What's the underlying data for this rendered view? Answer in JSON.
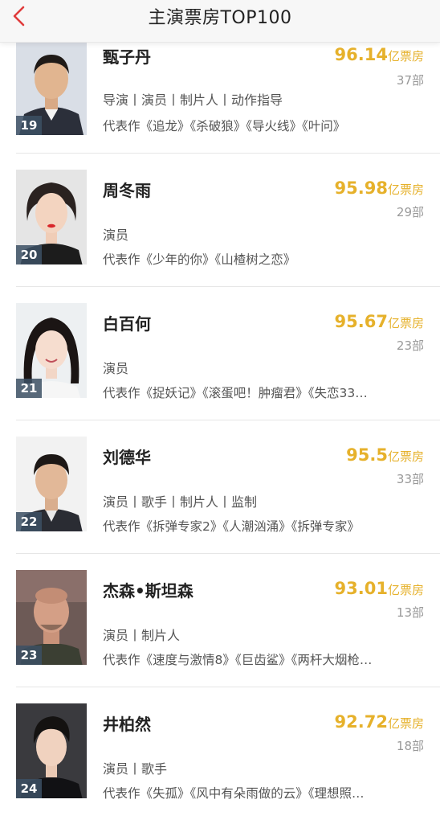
{
  "header": {
    "title": "主演票房TOP100",
    "back_icon": "chevron-left-icon",
    "accent": "#e03c3c"
  },
  "colors": {
    "gross": "#e6b12b",
    "rank_badge": "#3c5064"
  },
  "actors": [
    {
      "rank": "19",
      "name": "甄子丹",
      "gross": "96.14",
      "gross_unit": "亿票房",
      "films": "37部",
      "roles": "导演丨演员丨制片人丨动作指导",
      "works": "代表作《追龙》《杀破狼》《导火线》《叶问》"
    },
    {
      "rank": "20",
      "name": "周冬雨",
      "gross": "95.98",
      "gross_unit": "亿票房",
      "films": "29部",
      "roles": "演员",
      "works": "代表作《少年的你》《山楂树之恋》"
    },
    {
      "rank": "21",
      "name": "白百何",
      "gross": "95.67",
      "gross_unit": "亿票房",
      "films": "23部",
      "roles": "演员",
      "works": "代表作《捉妖记》《滚蛋吧！肿瘤君》《失恋33…"
    },
    {
      "rank": "22",
      "name": "刘德华",
      "gross": "95.5",
      "gross_unit": "亿票房",
      "films": "33部",
      "roles": "演员丨歌手丨制片人丨监制",
      "works": "代表作《拆弹专家2》《人潮汹涌》《拆弹专家》"
    },
    {
      "rank": "23",
      "name": "杰森•斯坦森",
      "gross": "93.01",
      "gross_unit": "亿票房",
      "films": "13部",
      "roles": "演员丨制片人",
      "works": "代表作《速度与激情8》《巨齿鲨》《两杆大烟枪…"
    },
    {
      "rank": "24",
      "name": "井柏然",
      "gross": "92.72",
      "gross_unit": "亿票房",
      "films": "18部",
      "roles": "演员丨歌手",
      "works": "代表作《失孤》《风中有朵雨做的云》《理想照…"
    }
  ]
}
